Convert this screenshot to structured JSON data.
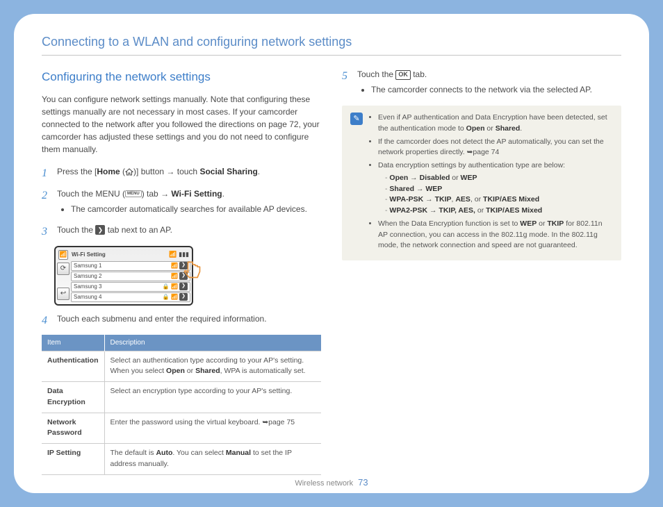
{
  "header": {
    "title": "Connecting to a WLAN and configuring network settings"
  },
  "section": {
    "title": "Configuring the network settings"
  },
  "intro": "You can configure network settings manually. Note that configuring these settings manually are not necessary in most cases. If your camcorder connected to the network after you followed the directions on page 72, your camcorder has adjusted these settings and you do not need to configure them manually.",
  "steps": {
    "s1": {
      "num": "1",
      "a": "Press the [",
      "home": "Home",
      "b": " (",
      "c": ")] button → touch ",
      "social": "Social Sharing",
      "d": "."
    },
    "s2": {
      "num": "2",
      "a": "Touch the MENU (",
      "menu": "MENU",
      "b": ") tab → ",
      "wifi": "Wi-Fi Setting",
      "c": ".",
      "bullet": "The camcorder automatically searches for available AP devices."
    },
    "s3": {
      "num": "3",
      "a": "Touch the ",
      "b": " tab next to an AP."
    },
    "s4": {
      "num": "4",
      "text": "Touch each submenu and enter the required information."
    },
    "s5": {
      "num": "5",
      "a": "Touch the ",
      "ok": "OK",
      "b": " tab.",
      "bullet": "The camcorder connects to the network via the selected AP."
    }
  },
  "wifi": {
    "title": "Wi-Fi Setting",
    "rows": [
      "Samsung 1",
      "Samsung 2",
      "Samsung 3",
      "Samsung 4"
    ]
  },
  "table": {
    "h1": "Item",
    "h2": "Description",
    "rows": [
      {
        "item": "Authentication",
        "desc_a": "Select an authentication type according to your AP's setting. When you select ",
        "b1": "Open",
        "mid": " or ",
        "b2": "Shared",
        "desc_b": ", WPA is automatically set."
      },
      {
        "item": "Data Encryption",
        "desc": "Select an encryption type according to your AP's setting."
      },
      {
        "item": "Network Password",
        "desc": "Enter the password using the virtual keyboard. ➥page 75"
      },
      {
        "item": "IP Setting",
        "desc_a": "The default is ",
        "b1": "Auto",
        "mid": ". You can select ",
        "b2": "Manual",
        "desc_b": " to set the IP address manually."
      }
    ]
  },
  "note": {
    "n1a": "Even if AP authentication and Data Encryption have been detected, set the authentication mode to ",
    "n1b1": "Open",
    "n1mid": " or ",
    "n1b2": "Shared",
    "n1c": ".",
    "n2": "If the camcorder does not detect the AP automatically, you can set the network properties directly. ➥page 74",
    "n3": "Data encryption settings by authentication type are below:",
    "enc": [
      {
        "a": "Open",
        "b": "Disabled",
        "mid": " or ",
        "c": "WEP"
      },
      {
        "a": "Shared",
        "b": "WEP"
      },
      {
        "a": "WPA-PSK",
        "b": "TKIP",
        "mid": ", ",
        "c": "AES",
        "mid2": ", or ",
        "d": "TKIP/AES Mixed"
      },
      {
        "a": "WPA2-PSK",
        "b": "TKIP, AES,",
        "mid": " or ",
        "c": "TKIP/AES Mixed"
      }
    ],
    "n4a": "When the Data Encryption function is set to ",
    "n4b1": "WEP",
    "n4mid": " or ",
    "n4b2": "TKIP",
    "n4b": " for 802.11n AP connection, you can access in the 802.11g mode. In the 802.11g mode, the network connection and speed are not guaranteed."
  },
  "footer": {
    "section": "Wireless network",
    "page": "73"
  }
}
